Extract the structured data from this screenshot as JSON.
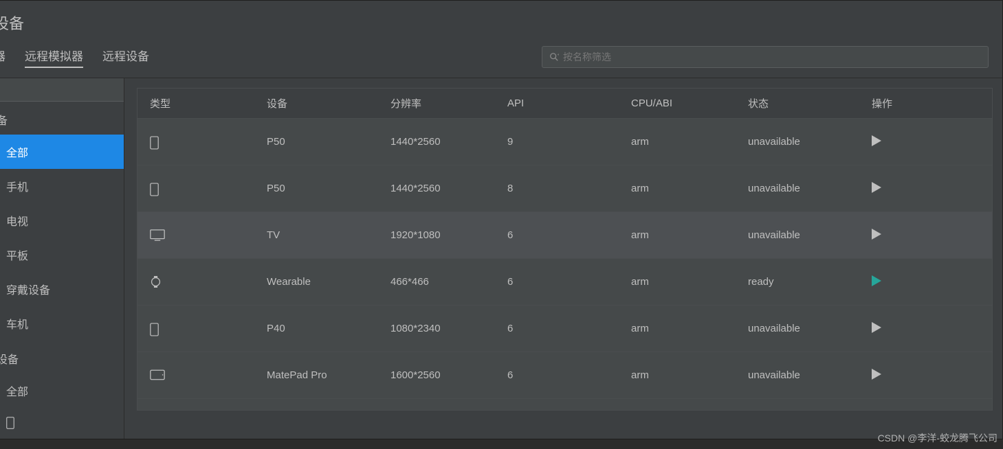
{
  "title": "设备",
  "tabs": [
    {
      "label": "器",
      "active": false
    },
    {
      "label": "远程模拟器",
      "active": true
    },
    {
      "label": "远程设备",
      "active": false
    }
  ],
  "search": {
    "placeholder": "按名称筛选"
  },
  "sidebar": {
    "group_remote": "备",
    "items": [
      {
        "label": "全部",
        "active": true
      },
      {
        "label": "手机",
        "active": false
      },
      {
        "label": "电视",
        "active": false
      },
      {
        "label": "平板",
        "active": false
      },
      {
        "label": "穿戴设备",
        "active": false
      },
      {
        "label": "车机",
        "active": false
      }
    ],
    "group_my": "设备",
    "my_items": [
      {
        "label": "全部",
        "active": false
      }
    ]
  },
  "table": {
    "headers": {
      "type": "类型",
      "device": "设备",
      "resolution": "分辨率",
      "api": "API",
      "cpu": "CPU/ABI",
      "status": "状态",
      "action": "操作"
    },
    "rows": [
      {
        "type_icon": "phone",
        "device": "P50",
        "resolution": "1440*2560",
        "api": "9",
        "cpu": "arm",
        "status": "unavailable",
        "ready": false
      },
      {
        "type_icon": "phone",
        "device": "P50",
        "resolution": "1440*2560",
        "api": "8",
        "cpu": "arm",
        "status": "unavailable",
        "ready": false
      },
      {
        "type_icon": "tv",
        "device": "TV",
        "resolution": "1920*1080",
        "api": "6",
        "cpu": "arm",
        "status": "unavailable",
        "ready": false
      },
      {
        "type_icon": "watch",
        "device": "Wearable",
        "resolution": "466*466",
        "api": "6",
        "cpu": "arm",
        "status": "ready",
        "ready": true
      },
      {
        "type_icon": "phone",
        "device": "P40",
        "resolution": "1080*2340",
        "api": "6",
        "cpu": "arm",
        "status": "unavailable",
        "ready": false
      },
      {
        "type_icon": "tablet",
        "device": "MatePad Pro",
        "resolution": "1600*2560",
        "api": "6",
        "cpu": "arm",
        "status": "unavailable",
        "ready": false
      }
    ]
  },
  "watermark": "CSDN @李洋-蛟龙腾飞公司"
}
